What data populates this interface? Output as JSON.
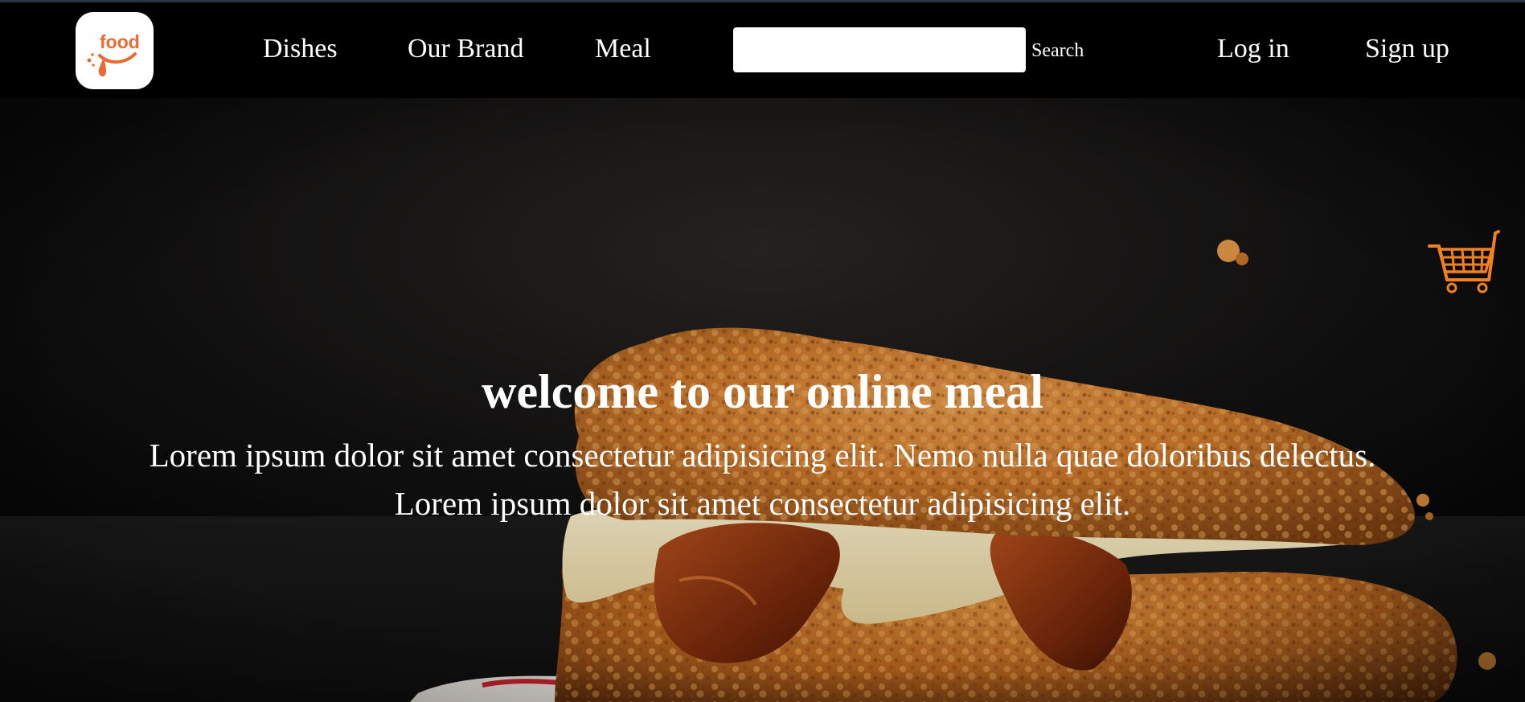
{
  "header": {
    "logo_text": "food",
    "nav": {
      "dishes": "Dishes",
      "our_brand": "Our Brand",
      "meal": "Meal"
    },
    "search": {
      "placeholder": "",
      "value": "",
      "button_label": "Search"
    },
    "auth": {
      "login": "Log in",
      "signup": "Sign up"
    }
  },
  "hero": {
    "title": "welcome to our online meal",
    "text": "Lorem ipsum dolor sit amet consectetur adipisicing elit. Nemo nulla quae doloribus delectus. Lorem ipsum dolor sit amet consectetur adipisicing elit.",
    "cart_icon": "shopping-cart-icon",
    "image": "fried-chicken-sandwich-photo"
  },
  "colors": {
    "brand_orange": "#ea6a33",
    "cart_orange": "#f2801f",
    "nav_background": "#000000",
    "text": "#ffffff"
  }
}
